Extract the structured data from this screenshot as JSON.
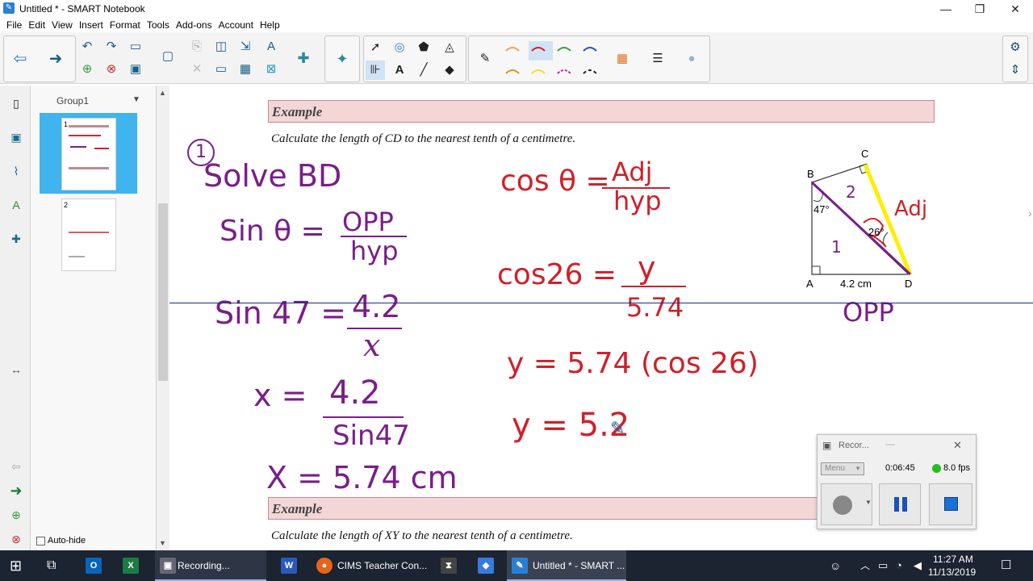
{
  "window": {
    "title": "Untitled * - SMART Notebook",
    "minimize": "—",
    "restore": "❐",
    "close": "✕"
  },
  "menu": [
    "File",
    "Edit",
    "View",
    "Insert",
    "Format",
    "Tools",
    "Add-ons",
    "Account",
    "Help"
  ],
  "sorter": {
    "group_label": "Group1",
    "page1": "1",
    "page2": "2",
    "autohide_label": "Auto-hide"
  },
  "examples": [
    {
      "heading": "Example",
      "question": "Calculate the length of CD to the nearest tenth of a centimetre."
    },
    {
      "heading": "Example",
      "question": "Calculate the length of XY to the nearest tenth of a centimetre."
    }
  ],
  "diagram": {
    "B": "B",
    "C": "C",
    "A": "A",
    "D": "D",
    "angle_B": "47°",
    "angle_D": "26°",
    "base": "4.2 cm",
    "label_1": "1",
    "label_2": "2",
    "adj": "Adj",
    "opp": "OPP"
  },
  "handwriting": {
    "circle1": "1",
    "solve": "Solve BD",
    "sin_theta": "Sin θ =",
    "opp": "OPP",
    "hyp": "hyp",
    "sin47": "Sin 47 =",
    "num42": "4.2",
    "x": "x",
    "x_eq": "x =",
    "num42b": "4.2",
    "sin47b": "Sin47",
    "x_result": "X = 5.74 cm",
    "cos_theta": "cos θ =",
    "adj": "Adj",
    "hyp2": "hyp",
    "cos26": "cos26 =",
    "y": "y",
    "num574": "5.74",
    "y_eq1": "y = 5.74 (cos 26)",
    "y_eq2": "y = 5.2"
  },
  "recorder": {
    "title": "Recor...",
    "menu": "Menu",
    "time": "0:06:45",
    "fps": "8.0 fps"
  },
  "taskbar": {
    "items": [
      "Recording...",
      "CIMS Teacher Con...",
      "Untitled * - SMART ..."
    ],
    "time": "11:27 AM",
    "date": "11/13/2019"
  },
  "colors": {
    "accent": "#2a7fd4",
    "handwriting_purple": "#7a1e8a",
    "handwriting_red": "#d0202a",
    "highlight": "#ffee00",
    "example_bar": "#f3d6d6"
  }
}
